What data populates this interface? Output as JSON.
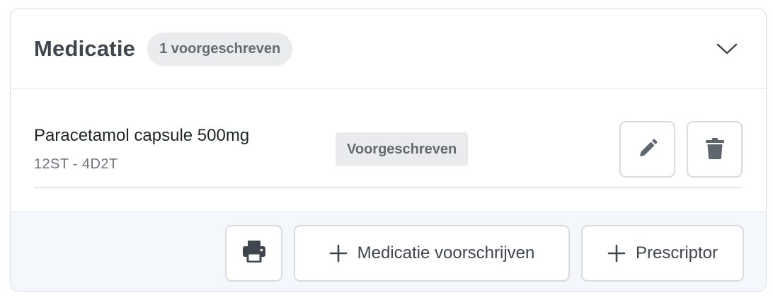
{
  "section": {
    "title": "Medicatie",
    "count_badge": "1 voorgeschreven"
  },
  "medications": [
    {
      "name": "Paracetamol capsule 500mg",
      "dosage": "12ST - 4D2T",
      "status": "Voorgeschreven"
    }
  ],
  "footer": {
    "prescribe_label": "Medicatie voorschrijven",
    "prescriptor_label": "Prescriptor"
  },
  "icons": {
    "collapse": "chevron-down-icon",
    "edit": "pencil-icon",
    "delete": "trash-icon",
    "print": "printer-icon",
    "add": "plus-icon"
  },
  "colors": {
    "title_text": "#3f464d",
    "badge_bg": "#e9ebed",
    "badge_text": "#636a71",
    "footer_bg": "#f4f7fb",
    "icon": "#5f666d"
  }
}
